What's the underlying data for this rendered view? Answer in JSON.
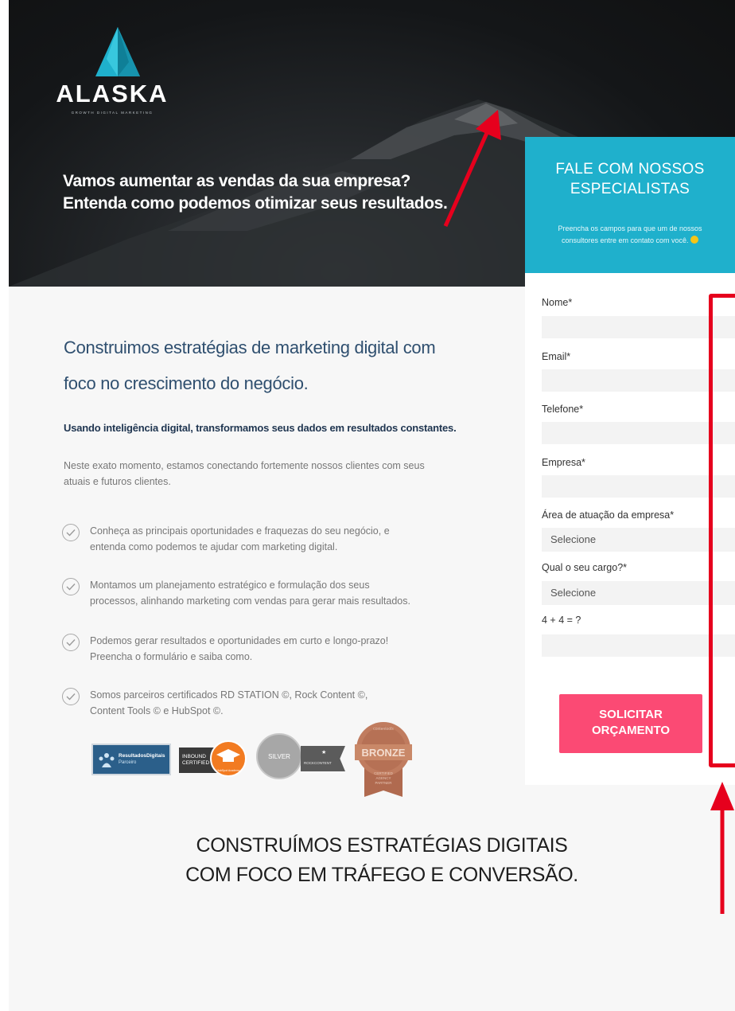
{
  "brand": {
    "name": "ALASKA",
    "tagline": "GROWTH DIGITAL MARKETING"
  },
  "hero": {
    "line1": "Vamos aumentar as vendas da sua empresa?",
    "line2": "Entenda como podemos otimizar seus resultados."
  },
  "main": {
    "heading_line1": "Construimos estratégias de marketing digital com",
    "heading_line2": "foco no crescimento do negócio.",
    "subheading": "Usando inteligência digital, transformamos seus dados em resultados constantes.",
    "paragraph_line1": "Neste exato momento, estamos conectando fortemente nossos clientes com seus",
    "paragraph_line2": "atuais e futuros clientes.",
    "bullets": [
      {
        "line1": "Conheça as principais oportunidades e fraquezas do seu negócio, e",
        "line2": "entenda como podemos te ajudar com marketing digital."
      },
      {
        "line1": "Montamos um planejamento estratégico e formulação dos seus",
        "line2": "processos, alinhando marketing com vendas para gerar mais resultados."
      },
      {
        "line1": "Podemos gerar resultados e oportunidades em curto e longo-prazo!",
        "line2": "Preencha o formulário e saiba como."
      },
      {
        "line1": "Somos parceiros certificados RD STATION ©, Rock Content ©,",
        "line2": "Content Tools © e HubSpot ©."
      }
    ],
    "badges": {
      "rd_title": "ResultadosDigitais",
      "rd_sub": "Parceiro",
      "hubspot_line1": "INBOUND",
      "hubspot_line2": "CERTIFIED",
      "hubspot_sub": "HubSpot Academy",
      "silver_label": "SILVER",
      "silver_sub": "ROCKCONTENT",
      "bronze_label": "BRONZE",
      "bronze_top": "contentools",
      "bronze_sub1": "CERTIFIED",
      "bronze_sub2": "AGENCY",
      "bronze_sub3": "PARTNER"
    }
  },
  "form": {
    "title_line1": "FALE COM NOSSOS",
    "title_line2": "ESPECIALISTAS",
    "desc_line1": "Preencha os campos para que um de nossos",
    "desc_line2": "consultores entre em contato com você.",
    "fields": {
      "nome": "Nome*",
      "email": "Email*",
      "telefone": "Telefone*",
      "empresa": "Empresa*",
      "area": "Área de atuação da empresa*",
      "cargo": "Qual o seu cargo?*",
      "captcha": "4 + 4 = ?"
    },
    "area_selected": "Selecione",
    "cargo_selected": "Selecione",
    "submit_line1": "SOLICITAR",
    "submit_line2": "ORÇAMENTO"
  },
  "footer_section": {
    "title_line1": "CONSTRUÍMOS ESTRATÉGIAS DIGITAIS",
    "title_line2": "COM FOCO EM TRÁFEGO E CONVERSÃO."
  },
  "colors": {
    "form_header": "#1fb0cc",
    "submit": "#fb4a74",
    "annotation": "#e6001d",
    "heading": "#2f4f6f"
  }
}
